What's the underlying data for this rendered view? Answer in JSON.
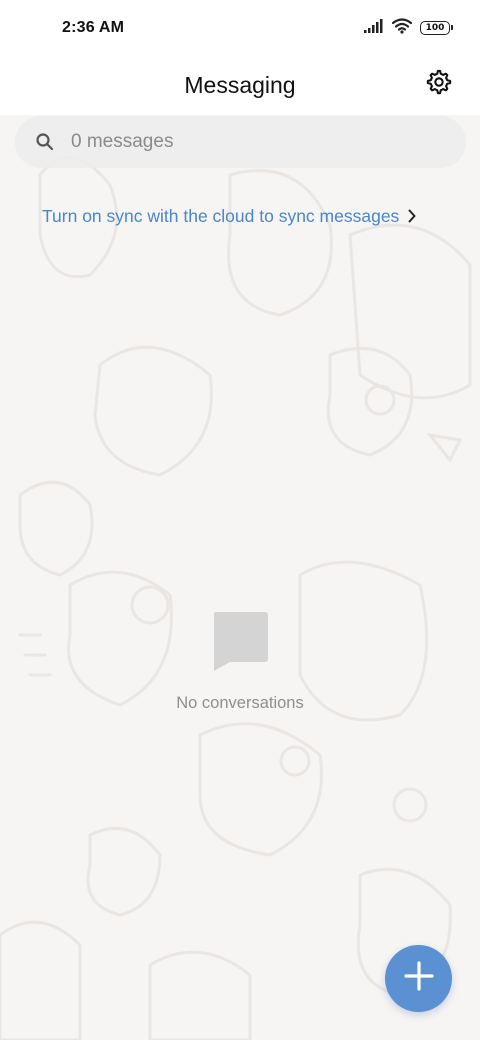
{
  "status_bar": {
    "time": "2:36 AM",
    "battery": "100",
    "icons": [
      "signal-icon",
      "wifi-icon",
      "battery-icon"
    ]
  },
  "header": {
    "title": "Messaging",
    "settings_icon": "gear-icon"
  },
  "search": {
    "placeholder": "0 messages",
    "value": ""
  },
  "sync": {
    "text": "Turn on sync with the cloud to sync messages"
  },
  "empty_state": {
    "text": "No conversations",
    "icon": "chat-bubble-icon"
  },
  "fab": {
    "icon": "plus-icon"
  },
  "colors": {
    "accent": "#5b91d3",
    "link": "#4a86c8",
    "muted_text": "#8e8e8e"
  }
}
